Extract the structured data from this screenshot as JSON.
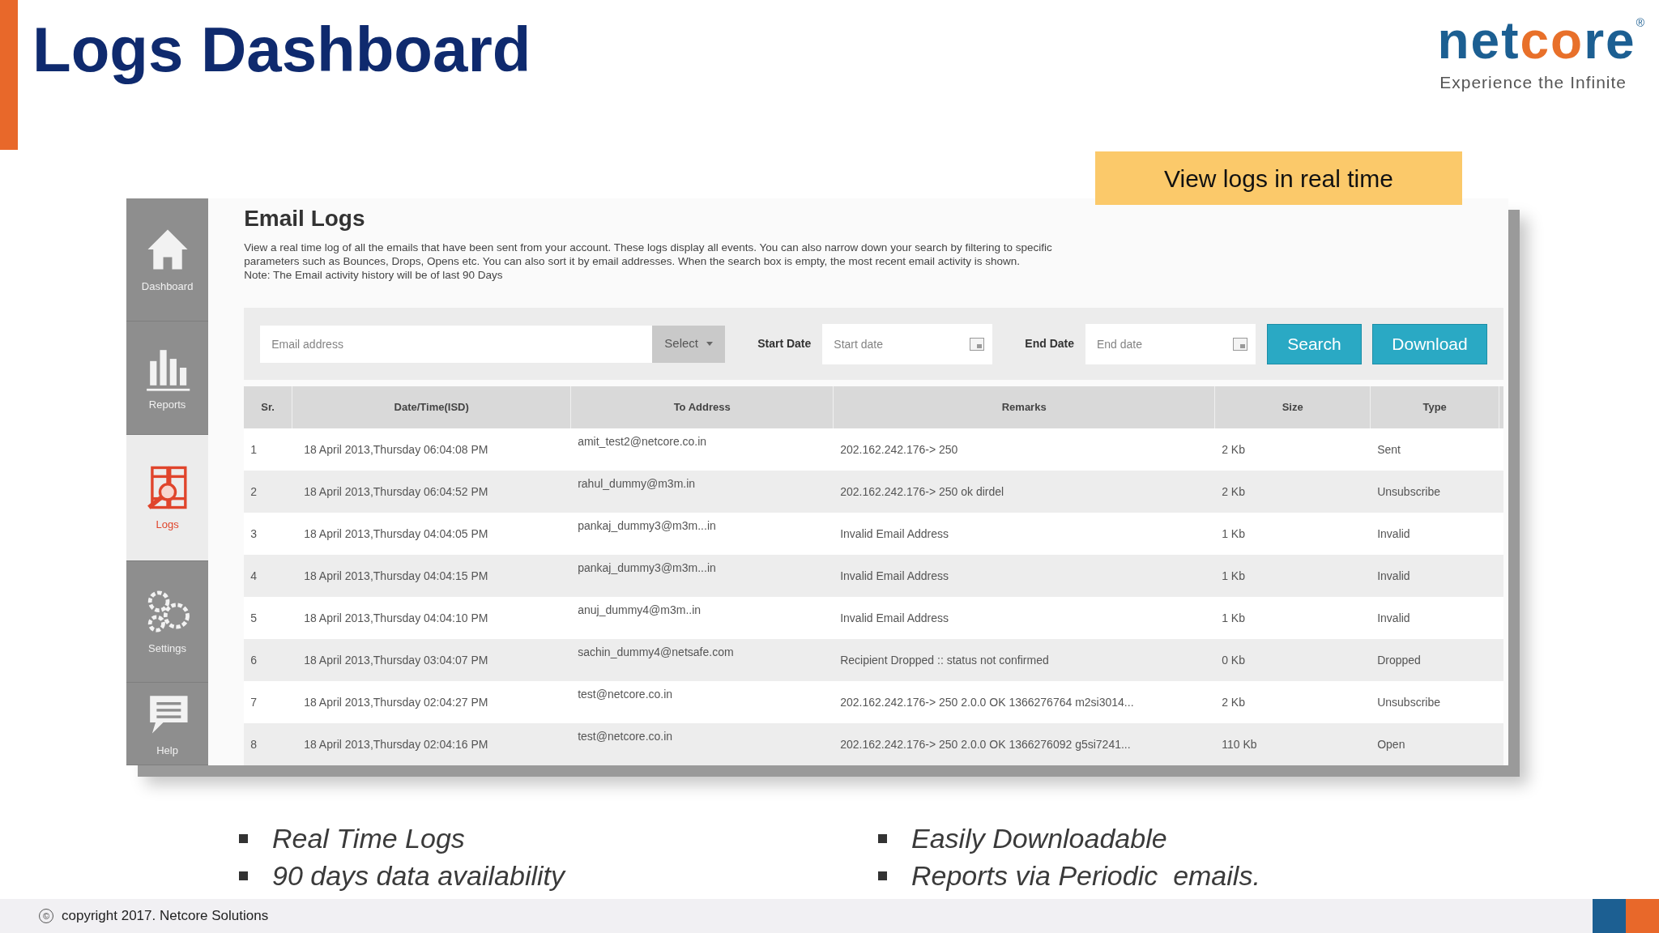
{
  "slide": {
    "title": "Logs Dashboard",
    "logo": {
      "parts": [
        "net",
        "co",
        "re"
      ],
      "registered": "®",
      "tagline": "Experience the Infinite"
    },
    "callout": "View logs in real time",
    "bullets_left": [
      "Real Time Logs",
      "90 days data availability"
    ],
    "bullets_right": [
      "Easily Downloadable",
      "Reports via Periodic  emails."
    ],
    "footer": {
      "copyright_icon": "©",
      "text": "copyright 2017. Netcore Solutions"
    }
  },
  "app": {
    "sidebar": {
      "items": [
        {
          "kind": "home",
          "label": "Dashboard",
          "selected": false
        },
        {
          "kind": "reports",
          "label": "Reports",
          "selected": false
        },
        {
          "kind": "logs",
          "label": "Logs",
          "selected": true
        },
        {
          "kind": "settings",
          "label": "Settings",
          "selected": false
        },
        {
          "kind": "help",
          "label": "Help",
          "selected": false
        }
      ]
    },
    "heading": "Email Logs",
    "description": [
      "View a real time log of all the emails that have been sent from your account. These logs display all events. You can also narrow down your search by filtering to specific",
      "parameters such as Bounces, Drops, Opens etc. You can also sort it by email addresses. When the search box is empty, the most recent email activity is shown.",
      "Note: The Email activity history will be of last 90 Days"
    ],
    "filters": {
      "email": {
        "placeholder": "Email address"
      },
      "select": "Select",
      "start_label": "Start Date",
      "start": {
        "placeholder": "Start date"
      },
      "end_label": "End Date",
      "end": {
        "placeholder": "End date"
      },
      "buttons": [
        "Search",
        "Download"
      ]
    },
    "table": {
      "columns": [
        "Sr.",
        "Date/Time(ISD)",
        "To Address",
        "Remarks",
        "Size",
        "Type"
      ],
      "rows": [
        [
          "1",
          "18 April 2013,Thursday 06:04:08 PM",
          "amit_test2@netcore.co.in",
          "202.162.242.176-> 250",
          "2 Kb",
          "Sent"
        ],
        [
          "2",
          "18 April 2013,Thursday 06:04:52 PM",
          "rahul_dummy@m3m.in",
          "202.162.242.176-> 250 ok dirdel",
          "2 Kb",
          "Unsubscribe"
        ],
        [
          "3",
          "18 April 2013,Thursday 04:04:05 PM",
          "pankaj_dummy3@m3m...in",
          "Invalid Email Address",
          "1 Kb",
          "Invalid"
        ],
        [
          "4",
          "18 April 2013,Thursday 04:04:15 PM",
          "pankaj_dummy3@m3m...in",
          "Invalid Email Address",
          "1 Kb",
          "Invalid"
        ],
        [
          "5",
          "18 April 2013,Thursday 04:04:10 PM",
          "anuj_dummy4@m3m..in",
          "Invalid Email Address",
          "1 Kb",
          "Invalid"
        ],
        [
          "6",
          "18 April 2013,Thursday 03:04:07 PM",
          "sachin_dummy4@netsafe.com",
          "Recipient Dropped :: status not confirmed",
          "0 Kb",
          "Dropped"
        ],
        [
          "7",
          "18 April 2013,Thursday 02:04:27 PM",
          "test@netcore.co.in",
          "202.162.242.176-> 250 2.0.0 OK 1366276764 m2si3014...",
          "2 Kb",
          "Unsubscribe"
        ],
        [
          "8",
          "18 April 2013,Thursday 02:04:16 PM",
          "test@netcore.co.in",
          "202.162.242.176-> 250 2.0.0 OK 1366276092 g5si7241...",
          "110 Kb",
          "Open"
        ]
      ]
    }
  }
}
